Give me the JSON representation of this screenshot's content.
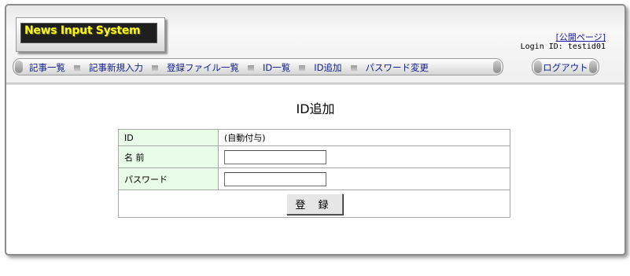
{
  "header": {
    "logo_text": "News Input System",
    "public_page_link": "[公開ページ]",
    "login_id_text": "Login ID: testid01"
  },
  "nav": {
    "items": [
      "記事一覧",
      "記事新規入力",
      "登録ファイル一覧",
      "ID一覧",
      "ID追加",
      "パスワード変更"
    ],
    "logout_label": "ログアウト"
  },
  "main": {
    "title": "ID追加",
    "form": {
      "rows": [
        {
          "label": "ID",
          "value": "(自動付与)"
        },
        {
          "label": "名 前",
          "value": ""
        },
        {
          "label": "パスワード",
          "value": ""
        }
      ],
      "submit_label": "登 録"
    }
  }
}
